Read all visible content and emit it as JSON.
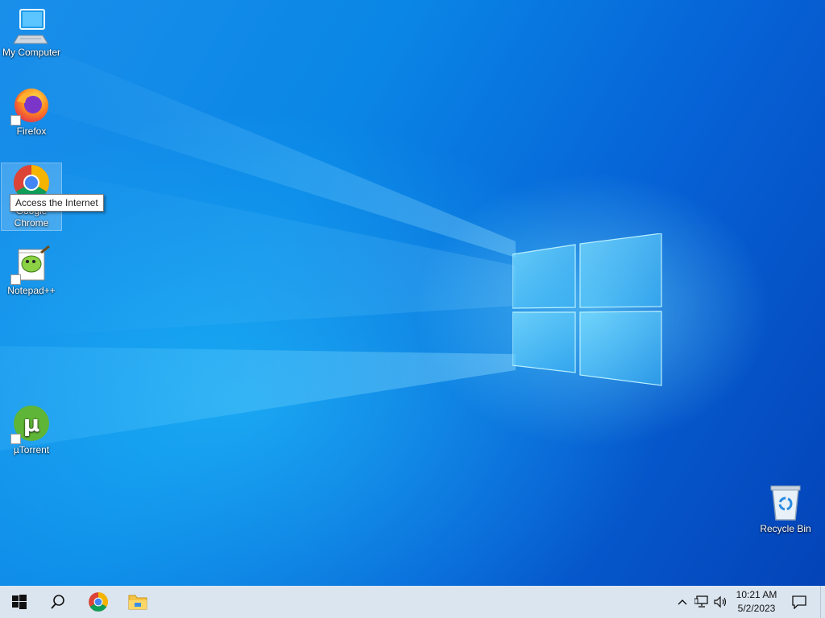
{
  "desktop": {
    "icons": [
      {
        "label": "My Computer",
        "icon": "computer-icon"
      },
      {
        "label": "Firefox",
        "icon": "firefox-icon",
        "shortcut": true
      },
      {
        "label": "Google Chrome",
        "icon": "chrome-icon",
        "selected": true
      },
      {
        "label": "Notepad++",
        "icon": "notepad-plus-plus-icon",
        "shortcut": true
      },
      {
        "label": "µTorrent",
        "icon": "utorrent-icon",
        "shortcut": true
      },
      {
        "label": "Recycle Bin",
        "icon": "recycle-bin-icon"
      }
    ],
    "tooltip": "Access the Internet"
  },
  "taskbar": {
    "buttons": [
      {
        "name": "start",
        "icon": "windows-icon"
      },
      {
        "name": "search",
        "icon": "search-icon"
      },
      {
        "name": "chrome",
        "icon": "chrome-icon"
      },
      {
        "name": "file-explorer",
        "icon": "folder-icon"
      }
    ],
    "tray": {
      "icons": [
        "chevron-up-icon",
        "network-icon",
        "volume-icon"
      ],
      "time": "10:21 AM",
      "date": "5/2/2023",
      "notification_icon": "notification-icon"
    }
  }
}
